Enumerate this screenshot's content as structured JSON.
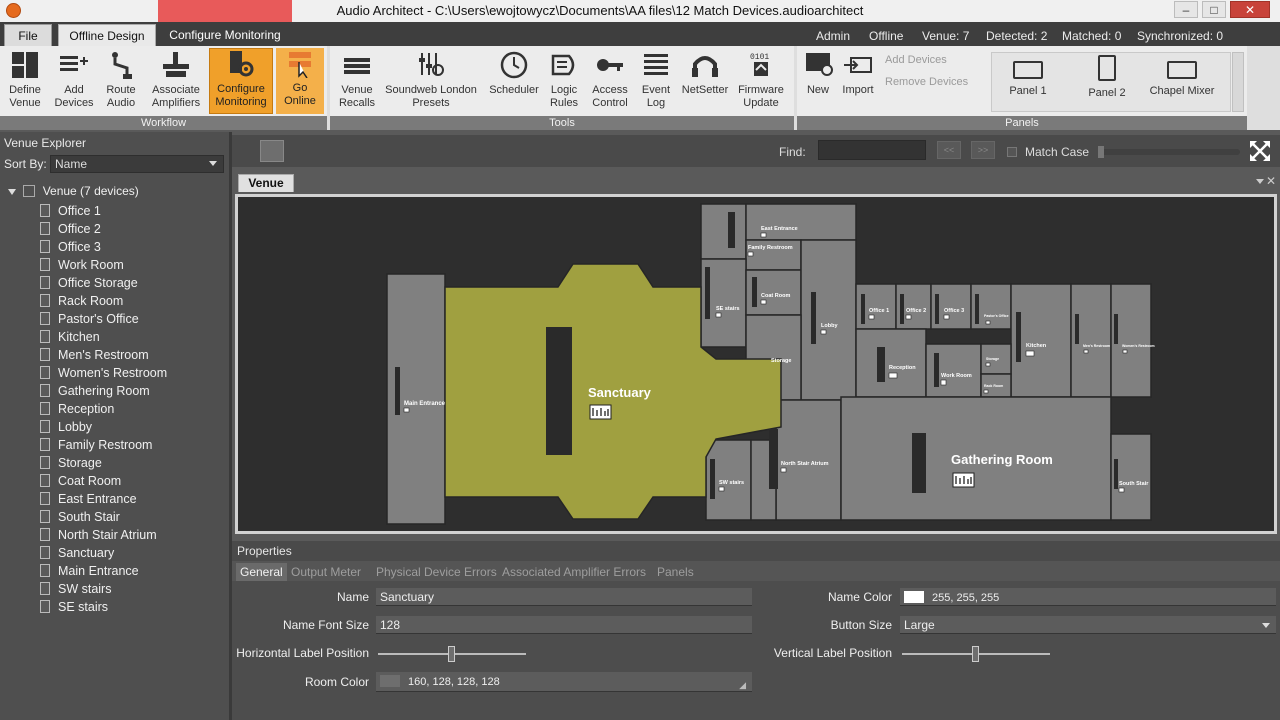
{
  "window": {
    "title": "Audio Architect - C:\\Users\\ewojtowycz\\Documents\\AA files\\12 Match Devices.audioarchitect",
    "controls": {
      "minimize": "–",
      "maximize": "□",
      "close": "✕"
    }
  },
  "tabs": {
    "file": "File",
    "offline_design": "Offline Design",
    "configure_monitoring": "Configure Monitoring"
  },
  "status": {
    "user": "Admin",
    "mode": "Offline",
    "venue": "Venue: 7",
    "detected": "Detected: 2",
    "matched": "Matched: 0",
    "synchronized": "Synchronized: 0"
  },
  "ribbon": {
    "workflow": {
      "label": "Workflow",
      "define_venue": "Define Venue",
      "add_devices": "Add Devices",
      "route_audio": "Route Audio",
      "associate_amplifiers": "Associate Amplifiers",
      "configure_monitoring": "Configure Monitoring",
      "go_online": "Go Online"
    },
    "tools": {
      "label": "Tools",
      "venue_recalls": "Venue Recalls",
      "soundweb_presets": "Soundweb London Presets",
      "scheduler": "Scheduler",
      "logic_rules": "Logic Rules",
      "access_control": "Access Control",
      "event_log": "Event Log",
      "netsetter": "NetSetter",
      "firmware_update": "Firmware Update"
    },
    "panels": {
      "label": "Panels",
      "new": "New",
      "import": "Import",
      "add_devices": "Add Devices",
      "remove_devices": "Remove Devices",
      "panel1": "Panel 1",
      "panel2": "Panel 2",
      "chapel_mixer": "Chapel Mixer"
    }
  },
  "sidebar": {
    "title": "Venue Explorer",
    "sort_label": "Sort By:",
    "sort_value": "Name",
    "root": "Venue (7 devices)",
    "items": [
      "Office 1",
      "Office 2",
      "Office 3",
      "Work Room",
      "Office Storage",
      "Rack Room",
      "Pastor's Office",
      "Kitchen",
      "Men's Restroom",
      "Women's Restroom",
      "Gathering Room",
      "Reception",
      "Lobby",
      "Family Restroom",
      "Storage",
      "Coat Room",
      "East Entrance",
      "South Stair",
      "North Stair Atrium",
      "Sanctuary",
      "Main Entrance",
      "SW stairs",
      "SE stairs"
    ]
  },
  "findbar": {
    "find_label": "Find:",
    "find_value": "",
    "prev": "<<",
    "next": ">>",
    "match_case": "Match Case"
  },
  "document": {
    "tab": "Venue",
    "close": "✕"
  },
  "floorplan": {
    "sanctuary": "Sanctuary",
    "gathering_room": "Gathering Room",
    "main_entrance": "Main Entrance",
    "east_entrance": "East Entrance",
    "family_restroom": "Family Restroom",
    "se_stairs": "SE stairs",
    "coat_room": "Coat Room",
    "lobby": "Lobby",
    "storage": "Storage",
    "office1": "Office 1",
    "office2": "Office 2",
    "office3": "Office 3",
    "pastors_office": "Pastor's Office",
    "kitchen": "Kitchen",
    "mens_restroom": "Men's Restroom",
    "womens_restroom": "Women's Restroom",
    "reception": "Reception",
    "work_room": "Work Room",
    "storage_small": "Storage",
    "rack_room": "Rack Room",
    "north_stair_atrium": "North Stair Atrium",
    "sw_stairs": "SW stairs",
    "south_stair": "South Stair",
    "colors": {
      "sanctuary": "#a0a040",
      "room": "#808080",
      "background": "#2e2e2e"
    }
  },
  "properties": {
    "title": "Properties",
    "tabs": [
      "General",
      "Output Meter",
      "Physical Device Errors",
      "Associated Amplifier Errors",
      "Panels"
    ],
    "name_label": "Name",
    "name_value": "Sanctuary",
    "font_size_label": "Name Font Size",
    "font_size_value": "128",
    "h_label_pos_label": "Horizontal Label Position",
    "h_label_pos": 0.5,
    "room_color_label": "Room Color",
    "room_color_value": "160, 128, 128, 128",
    "name_color_label": "Name Color",
    "name_color_value": "255, 255, 255",
    "button_size_label": "Button Size",
    "button_size_value": "Large",
    "v_label_pos_label": "Vertical Label Position",
    "v_label_pos": 0.5
  }
}
